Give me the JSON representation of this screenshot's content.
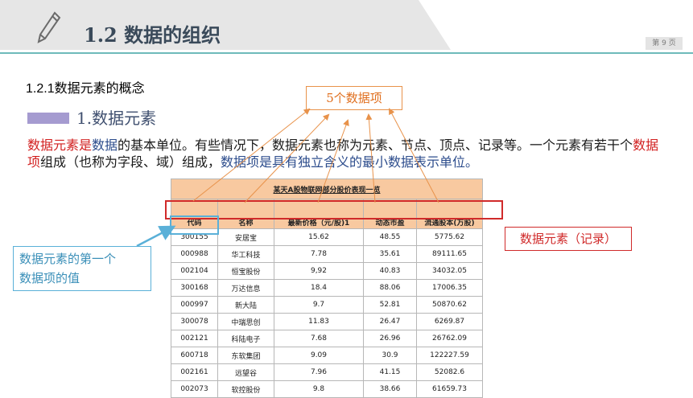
{
  "header": {
    "title": "1.2  数据的组织",
    "page_label": "第 9 页",
    "band_color": "#e6e6e6",
    "accent_line_color": "#3ea4a4"
  },
  "subsection": "1.2.1数据元素的概念",
  "section": {
    "title": "1.数据元素",
    "bar_color": "#a59bd0"
  },
  "paragraph": {
    "p1": "数据元素",
    "p2": "是",
    "p3": "数据",
    "p4": "的基本单位。有些情况下，数据元素也称为元素、节点、顶点、记录等。一个元素有若干个",
    "p5": "数据项",
    "p6": "组成（也称为字段、域）组成，",
    "p7": "数据项是具有独立含义的最小数据表示单位。"
  },
  "callouts": {
    "items": "5个数据项",
    "element": "数据元素（记录）",
    "first_item_line1": "数据元素的第一个",
    "first_item_line2": "数据项的值"
  },
  "table": {
    "title": "某天A股物联网部分股价表现一览",
    "headers": [
      "代码",
      "名称",
      "最新价格（元/股)1",
      "动态市盈",
      "流通股本(万股)"
    ],
    "rows": [
      [
        "300155",
        "安居宝",
        "15.62",
        "48.55",
        "5775.62"
      ],
      [
        "000988",
        "华工科技",
        "7.78",
        "35.61",
        "89111.65"
      ],
      [
        "002104",
        "恒宝股份",
        "9,92",
        "40.83",
        "34032.05"
      ],
      [
        "300168",
        "万达信息",
        "18.4",
        "88.06",
        "17006.35"
      ],
      [
        "000997",
        "新大陆",
        "9.7",
        "52.81",
        "50870.62"
      ],
      [
        "300078",
        "中瑞思创",
        "11.83",
        "26.47",
        "6269.87"
      ],
      [
        "002121",
        "科陆电子",
        "7.68",
        "26.96",
        "26762.09"
      ],
      [
        "600718",
        "东软集团",
        "9.09",
        "30.9",
        "122227.59"
      ],
      [
        "002161",
        "远望谷",
        "7.96",
        "41.15",
        "52082.6"
      ],
      [
        "002073",
        "软控股份",
        "9.8",
        "38.66",
        "61659.73"
      ]
    ]
  }
}
